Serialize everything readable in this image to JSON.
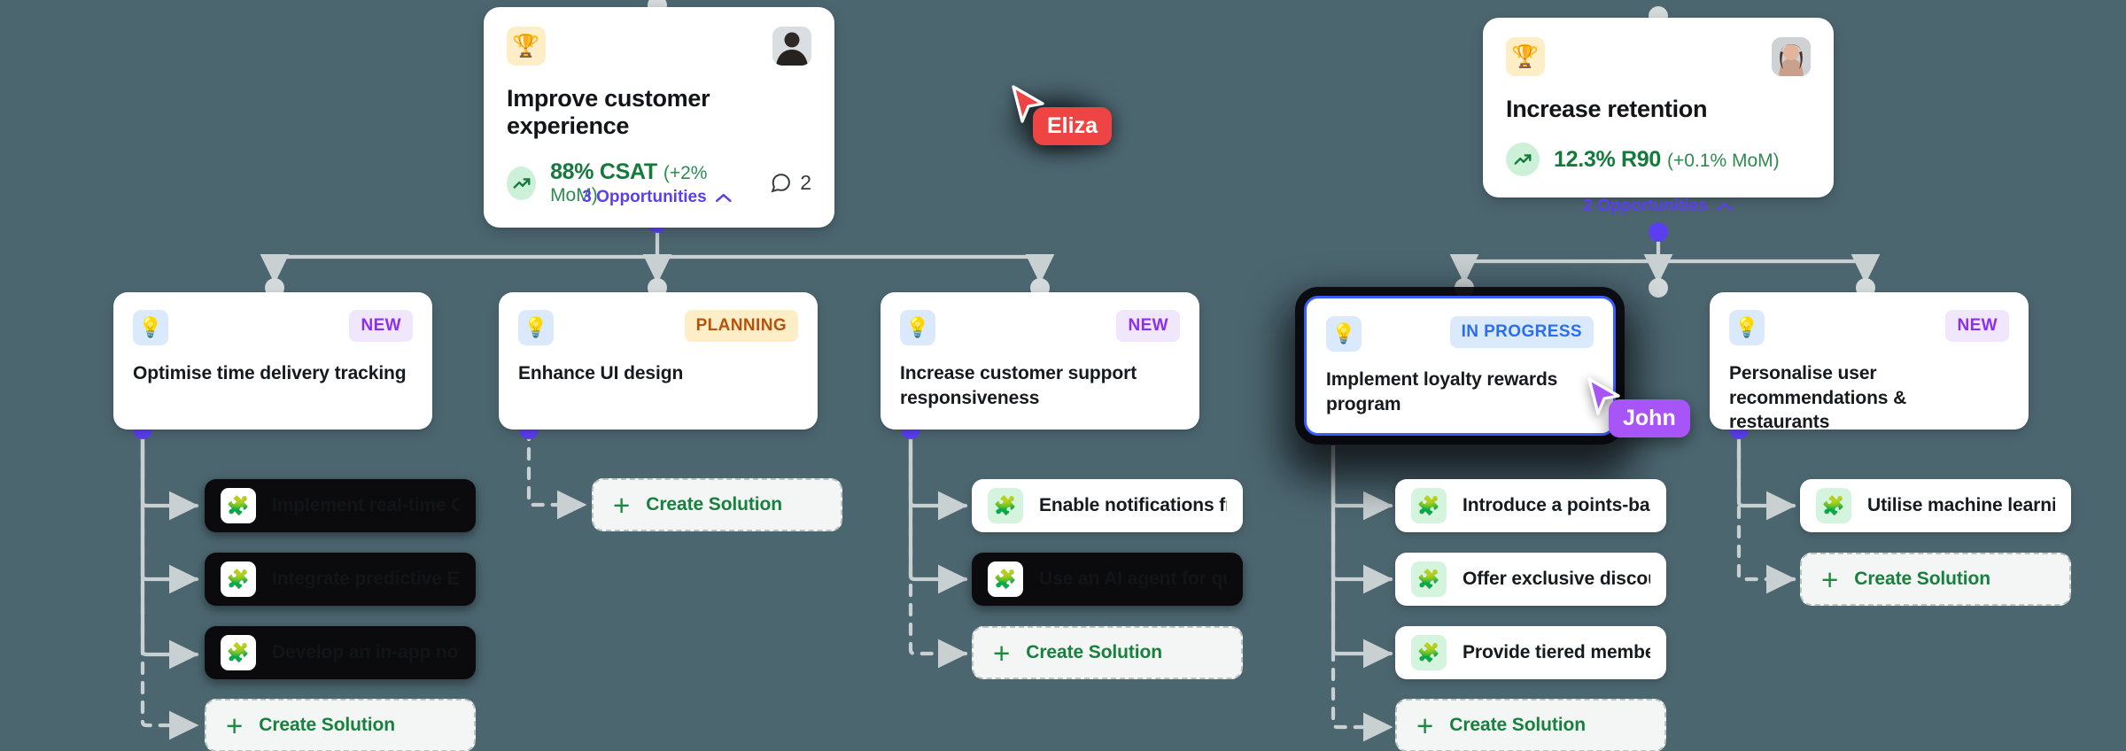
{
  "canvas": {
    "background": "#4c6670"
  },
  "goals": [
    {
      "id": "improve-customer-experience",
      "emoji": "🏆",
      "title": "Improve customer experience",
      "metric": "88% CSAT",
      "delta": "(+2% MoM)",
      "comments": "2",
      "opportunities_label": "3 Opportunities",
      "chevron": "⌃",
      "avatar_alt": "avatar"
    },
    {
      "id": "increase-retention",
      "emoji": "🏆",
      "title": "Increase retention",
      "metric": "12.3% R90",
      "delta": "(+0.1% MoM)",
      "comments": "",
      "opportunities_label": "2 Opportunities",
      "chevron": "⌃",
      "avatar_alt": "avatar"
    }
  ],
  "opportunities": [
    {
      "id": "optimise-time-delivery-tracking",
      "icon": "💡",
      "status": "NEW",
      "status_kind": "new",
      "title": "Optimise time delivery tracking"
    },
    {
      "id": "enhance-ui-design",
      "icon": "💡",
      "status": "PLANNING",
      "status_kind": "planning",
      "title": "Enhance UI design"
    },
    {
      "id": "increase-customer-support",
      "icon": "💡",
      "status": "NEW",
      "status_kind": "new",
      "title": "Increase customer support responsiveness"
    },
    {
      "id": "implement-loyalty-rewards",
      "icon": "💡",
      "status": "IN PROGRESS",
      "status_kind": "progress",
      "title": "Implement loyalty rewards program",
      "selected": true
    },
    {
      "id": "personalise-user-recommendations",
      "icon": "💡",
      "status": "NEW",
      "status_kind": "new",
      "title": "Personalise user recommendations & restaurants"
    }
  ],
  "solutions": {
    "col1": [
      {
        "id": "implement-real-time-gps",
        "icon": "🧩",
        "title": "Implement real-time GPS…",
        "dark": true
      },
      {
        "id": "integrate-predictive-eta",
        "icon": "🧩",
        "title": "Integrate predictive ETA…",
        "dark": true
      },
      {
        "id": "develop-in-app-notification",
        "icon": "🧩",
        "title": "Develop an in-app notifi…",
        "dark": true
      }
    ],
    "col2": [],
    "col3": [
      {
        "id": "enable-notifications-from",
        "icon": "🧩",
        "title": "Enable notifications from…",
        "dark": false
      },
      {
        "id": "use-an-ai-agent-for-quick",
        "icon": "🧩",
        "title": "Use an AI agent for quick…",
        "dark": true
      }
    ],
    "col4": [
      {
        "id": "introduce-points-based",
        "icon": "🧩",
        "title": "Introduce a points-base…",
        "dark": false
      },
      {
        "id": "offer-exclusive-discount",
        "icon": "🧩",
        "title": "Offer exclusive discount…",
        "dark": false
      },
      {
        "id": "provide-tiered-members",
        "icon": "🧩",
        "title": "Provide tiered members…",
        "dark": false
      }
    ],
    "col5": [
      {
        "id": "utilise-machine-learning",
        "icon": "🧩",
        "title": "Utilise machine learning…",
        "dark": false
      }
    ]
  },
  "create_solution": {
    "label": "Create Solution",
    "plus": "+"
  },
  "cursors": [
    {
      "id": "eliza",
      "name": "Eliza",
      "color": "#ef4444"
    },
    {
      "id": "john",
      "name": "John",
      "color": "#a855f7"
    }
  ],
  "colors": {
    "background": "#4c6670",
    "accent_purple": "#5b3ef0",
    "green": "#137a3b",
    "selected_border": "#3b5bfd"
  }
}
